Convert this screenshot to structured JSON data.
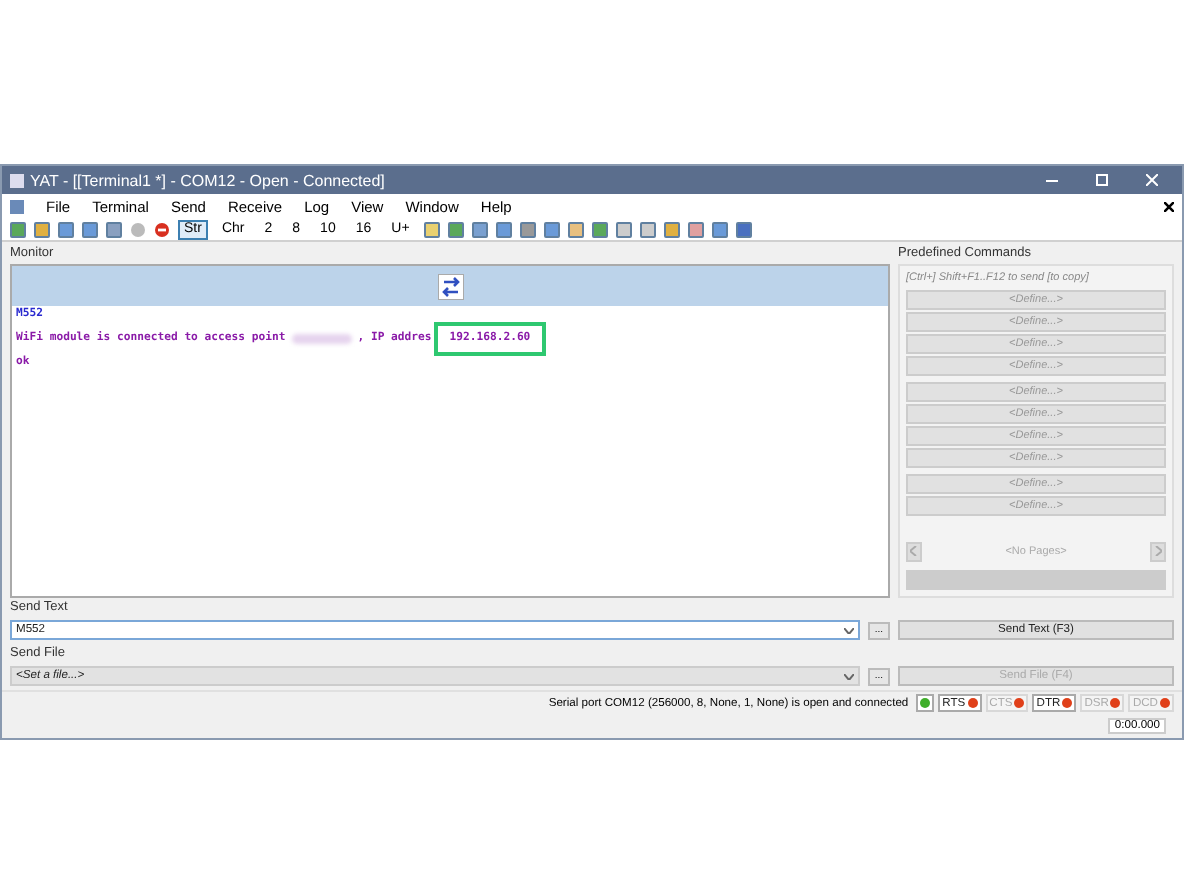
{
  "window": {
    "title": "YAT - [[Terminal1 *] - COM12 - Open - Connected]"
  },
  "menu": [
    "File",
    "Terminal",
    "Send",
    "Receive",
    "Log",
    "View",
    "Window",
    "Help"
  ],
  "radix_buttons": [
    {
      "label": "Str",
      "selected": true
    },
    {
      "label": "Chr",
      "selected": false
    },
    {
      "label": "2",
      "selected": false
    },
    {
      "label": "8",
      "selected": false
    },
    {
      "label": "10",
      "selected": false
    },
    {
      "label": "16",
      "selected": false
    },
    {
      "label": "U+",
      "selected": false
    }
  ],
  "monitor": {
    "title": "Monitor",
    "lines": [
      {
        "kind": "plain",
        "text": "M552",
        "color": "#2a2ad0"
      },
      {
        "kind": "redacted",
        "before": "WiFi module is connected to access point",
        "after": ", IP addres",
        "highlight": "192.168.2.60",
        "color": "#8a1aa8"
      },
      {
        "kind": "plain",
        "text": "ok",
        "color": "#8a1aa8"
      }
    ]
  },
  "predefined": {
    "title": "Predefined Commands",
    "hint": "[Ctrl+] Shift+F1..F12 to send [to copy]",
    "groups": [
      [
        "<Define...>",
        "<Define...>",
        "<Define...>",
        "<Define...>"
      ],
      [
        "<Define...>",
        "<Define...>",
        "<Define...>",
        "<Define...>"
      ],
      [
        "<Define...>",
        "<Define...>"
      ]
    ],
    "pages": "<No Pages>"
  },
  "send_text": {
    "title": "Send Text",
    "value": "M552",
    "button": "Send Text (F3)",
    "browse": "...",
    "disabled": false
  },
  "send_file": {
    "title": "Send File",
    "value": "<Set a file...>",
    "button": "Send File (F4)",
    "browse": "...",
    "disabled": true
  },
  "status_bar": {
    "message": "Serial port COM12 (256000, 8, None, 1, None) is open and connected",
    "leds": [
      {
        "color": "#3fae2a",
        "disabled": false
      },
      {
        "label": "RTS",
        "color": "#e0401a",
        "disabled": false
      },
      {
        "label": "CTS",
        "color": "#e0401a",
        "disabled": true
      },
      {
        "label": "DTR",
        "color": "#e0401a",
        "disabled": false
      },
      {
        "label": "DSR",
        "color": "#e0401a",
        "disabled": true
      },
      {
        "label": "DCD",
        "color": "#e0401a",
        "disabled": true
      }
    ],
    "time": "0:00.000"
  }
}
